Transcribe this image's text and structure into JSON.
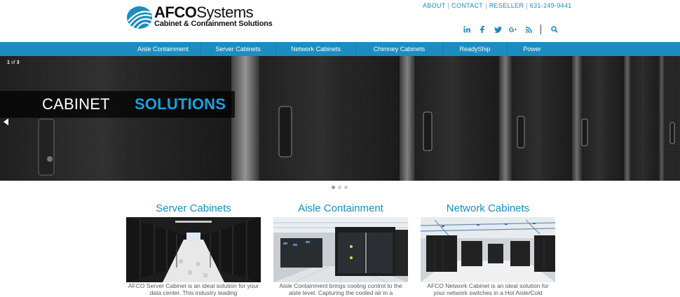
{
  "brand": {
    "name_bold": "AFCO",
    "name_regular": "Systems",
    "tagline": "Cabinet & Containment Solutions",
    "accent": "#1b8dbf",
    "highlight": "#1aa0e0"
  },
  "toplinks": {
    "about": "ABOUT",
    "contact": "CONTACT",
    "reseller": "RESELLER",
    "phone": "631-249-9441",
    "separator": "|"
  },
  "social": [
    {
      "icon": "linkedin-icon",
      "glyph": "in"
    },
    {
      "icon": "facebook-icon",
      "glyph": "f"
    },
    {
      "icon": "twitter-icon",
      "glyph": "t"
    },
    {
      "icon": "google-plus-icon",
      "glyph": "g+"
    },
    {
      "icon": "rss-icon",
      "glyph": "rss"
    },
    {
      "icon": "search-icon",
      "glyph": "search"
    }
  ],
  "nav": {
    "items": [
      {
        "label": "Aisle Containment"
      },
      {
        "label": "Server Cabinets"
      },
      {
        "label": "Network Cabinets"
      },
      {
        "label": "Chimney Cabinets"
      },
      {
        "label": "ReadyShip"
      },
      {
        "label": "Power"
      }
    ]
  },
  "slider": {
    "current": "1",
    "of": "of",
    "total": "3",
    "caption_white": "CABINET",
    "caption_blue": "SOLUTIONS",
    "active_slide": 1,
    "slide_count": 3
  },
  "cards": [
    {
      "title": "Server Cabinets",
      "text": "AFCO Server Cabinet is an ideal solution for your data center. This industry leading"
    },
    {
      "title": "Aisle Containment",
      "text": "Aisle Containment brings cooling control to the aisle level. Capturing the cooled air in a"
    },
    {
      "title": "Network Cabinets",
      "text": "AFCO Network Cabinet is an ideal solution for your network switches in a Hot Aisle/Cold"
    }
  ]
}
